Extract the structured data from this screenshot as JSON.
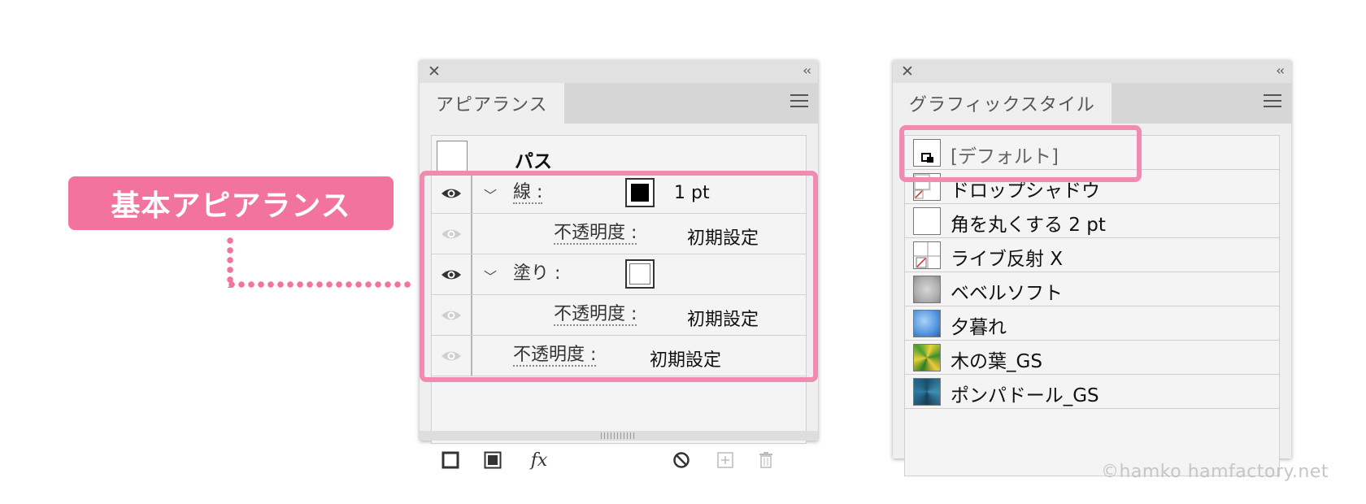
{
  "callout": {
    "label": "基本アピアランス"
  },
  "appearance_panel": {
    "tab_label": "アピアランス",
    "path_title": "パス",
    "rows": [
      {
        "type": "stroke",
        "label": "線 :",
        "value": "1 pt"
      },
      {
        "type": "opacity",
        "label": "不透明度 :",
        "value": "初期設定"
      },
      {
        "type": "fill",
        "label": "塗り :"
      },
      {
        "type": "opacity",
        "label": "不透明度 :",
        "value": "初期設定"
      },
      {
        "type": "opacity",
        "label": "不透明度 :",
        "value": "初期設定"
      }
    ],
    "footer_icons": [
      "add-new-stroke-icon",
      "add-new-fill-icon",
      "fx-icon",
      "clear-appearance-icon",
      "duplicate-item-icon",
      "delete-item-icon"
    ],
    "fx_label": "fx"
  },
  "graphic_styles_panel": {
    "tab_label": "グラフィックスタイル",
    "items": [
      {
        "label": "[デフォルト]",
        "icon": "default-style"
      },
      {
        "label": "ドロップシャドウ",
        "icon": "drop-shadow-style"
      },
      {
        "label": "角を丸くする 2 pt",
        "icon": "round-corners-style"
      },
      {
        "label": "ライブ反射 X",
        "icon": "live-reflect-style"
      },
      {
        "label": "ベベルソフト",
        "icon": "bevel-soft-style"
      },
      {
        "label": "夕暮れ",
        "icon": "sunset-style"
      },
      {
        "label": "木の葉_GS",
        "icon": "leaves-style"
      },
      {
        "label": "ポンパドール_GS",
        "icon": "pompadour-style"
      }
    ]
  },
  "colors": {
    "highlight": "#f28bb2",
    "callout_bg": "#f2739e"
  },
  "copyright": "©hamko  hamfactory.net"
}
